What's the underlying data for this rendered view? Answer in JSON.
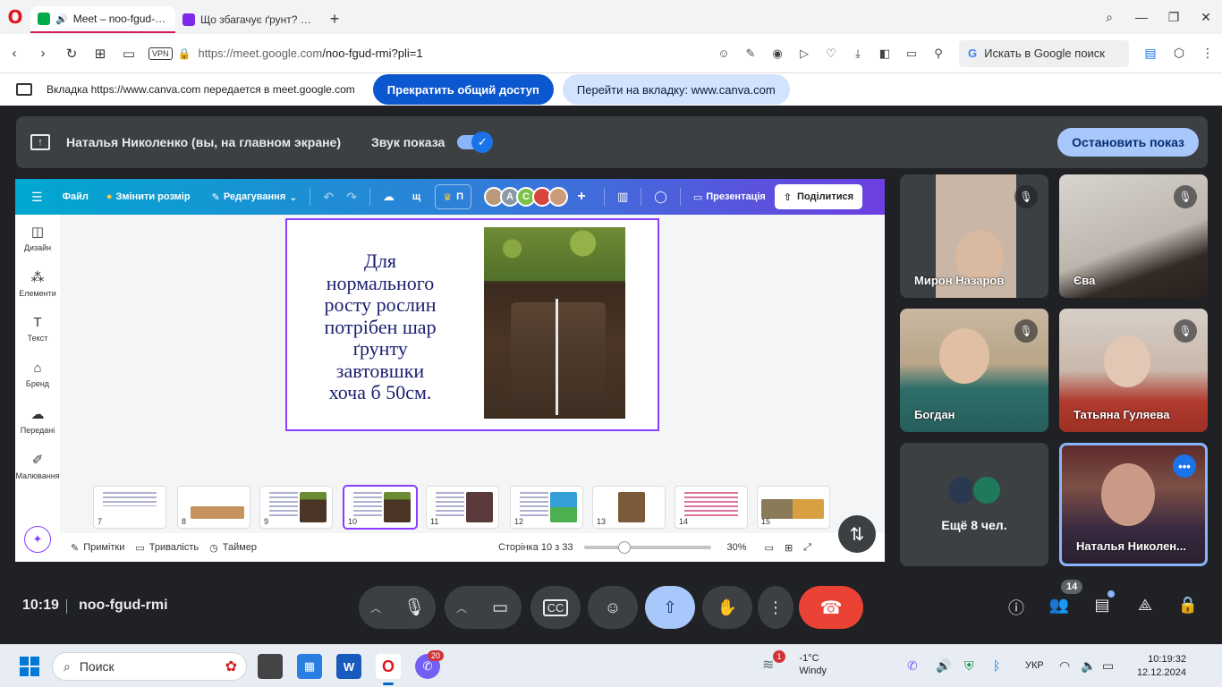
{
  "browser": {
    "tabs": [
      {
        "label": "Meet – noo-fgud-rmi",
        "active": true
      },
      {
        "label": "Що збагачує ґрунт? – Пре",
        "active": false
      }
    ],
    "url_domain": "https://meet.google.com",
    "url_path": "/noo-fgud-rmi?pli=1",
    "vpn_label": "VPN",
    "search_placeholder": "Искать в Google поиск"
  },
  "share_notice": {
    "text": "Вкладка https://www.canva.com передается в meet.google.com",
    "stop_label": "Прекратить общий доступ",
    "goto_label": "Перейти на вкладку: www.canva.com"
  },
  "meet": {
    "presenter_label": "Наталья Николенко (вы, на главном экране)",
    "sound_label": "Звук показа",
    "stop_show_label": "Остановить показ",
    "time": "10:19",
    "meeting_code": "noo-fgud-rmi",
    "participant_count": "14",
    "more_label": "Ещё 8 чел.",
    "participants": [
      {
        "name": "Мирон Назаров"
      },
      {
        "name": "Єва"
      },
      {
        "name": "Богдан"
      },
      {
        "name": "Татьяна Гуляева"
      },
      {
        "name": "Наталья Николен..."
      }
    ]
  },
  "canva": {
    "menu": {
      "file": "Файл",
      "resize": "Змінити розмір",
      "editing": "Редагування",
      "shortcut": "щ",
      "pro": "П",
      "presentation": "Презентація",
      "share": "Поділитися"
    },
    "collaborators": [
      "A",
      "C"
    ],
    "sidebar": [
      "Дизайн",
      "Елементи",
      "Текст",
      "Бренд",
      "Передані",
      "Малювання"
    ],
    "slide_text": [
      "Для",
      "нормального",
      "росту рослин",
      "потрібен шар",
      "ґрунту",
      "завтовшки",
      "хоча б 50см."
    ],
    "thumbnail_numbers": [
      "7",
      "8",
      "9",
      "10",
      "11",
      "12",
      "13",
      "14",
      "15"
    ],
    "bottom": {
      "notes": "Примітки",
      "duration": "Тривалість",
      "timer": "Таймер",
      "page": "Сторінка 10 з 33",
      "zoom": "30%"
    }
  },
  "taskbar": {
    "search_label": "Поиск",
    "weather_badge": "1",
    "weather_temp": "-1°C",
    "weather_desc": "Windy",
    "viber_badge": "20",
    "language": "УКР",
    "time": "10:19:32",
    "date": "12.12.2024"
  },
  "colors": {
    "meet_bg": "#202124",
    "share_blue": "#0b57d0",
    "end_call_red": "#ea4335",
    "canva_purple": "#8b3dff"
  }
}
